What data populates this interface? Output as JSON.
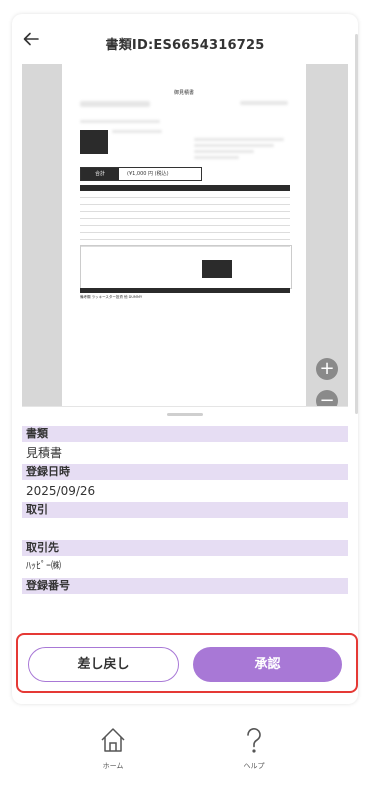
{
  "header": {
    "back_icon": "arrow-left-icon",
    "title": "書類ID:ES6654316725"
  },
  "preview": {
    "doc_title": "御見積書",
    "total_label": "合計",
    "total_value": "(¥1,000 円 (税込)",
    "note": "備考欄  ラッキースター投資  他  DUMMY",
    "zoom_in": "+",
    "zoom_out": "−"
  },
  "fields": [
    {
      "label": "書類",
      "value": "見積書"
    },
    {
      "label": "登録日時",
      "value": "2025/09/26"
    },
    {
      "label": "取引",
      "value": ""
    },
    {
      "label": "取引先",
      "value": "ﾊｯﾋﾟｰ㈱"
    },
    {
      "label": "登録番号",
      "value": ""
    }
  ],
  "actions": {
    "return_label": "差し戻し",
    "approve_label": "承認"
  },
  "nav": {
    "home_label": "ホーム",
    "help_label": "ヘルプ"
  },
  "colors": {
    "accent": "#a878d6",
    "label_bg": "#e6ddf3",
    "highlight": "#e53935"
  }
}
